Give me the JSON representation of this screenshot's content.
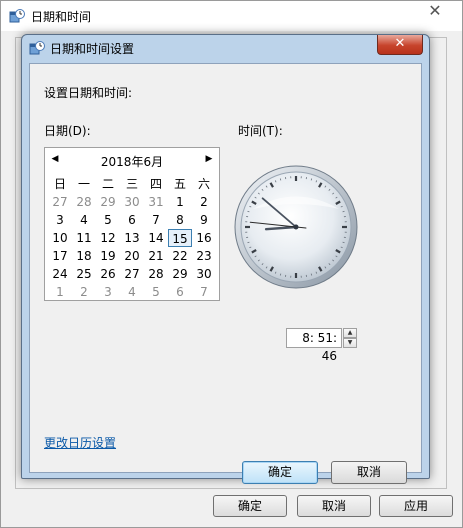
{
  "background_window": {
    "title": "日期和时间",
    "close_label": "✕",
    "ok_label": "确定",
    "cancel_label": "取消",
    "apply_label": "应用"
  },
  "dialog": {
    "title": "日期和时间设置",
    "close_label": "✕",
    "instruction": "设置日期和时间:",
    "date_label": "日期(D):",
    "time_label": "时间(T):",
    "calendar": {
      "month_title": "2018年6月",
      "prev_icon": "triangle-left-icon",
      "next_icon": "triangle-right-icon",
      "weekdays": [
        "日",
        "一",
        "二",
        "三",
        "四",
        "五",
        "六"
      ],
      "weeks": [
        [
          "27",
          "28",
          "29",
          "30",
          "31",
          "1",
          "2"
        ],
        [
          "3",
          "4",
          "5",
          "6",
          "7",
          "8",
          "9"
        ],
        [
          "10",
          "11",
          "12",
          "13",
          "14",
          "15",
          "16"
        ],
        [
          "17",
          "18",
          "19",
          "20",
          "21",
          "22",
          "23"
        ],
        [
          "24",
          "25",
          "26",
          "27",
          "28",
          "29",
          "30"
        ],
        [
          "1",
          "2",
          "3",
          "4",
          "5",
          "6",
          "7"
        ]
      ],
      "selected_day": "15"
    },
    "clock": {
      "hour": 8,
      "minute": 51,
      "second": 46
    },
    "time_value": "8: 51: 46",
    "change_calendar_link": "更改日历设置",
    "ok_label": "确定",
    "cancel_label": "取消"
  },
  "colors": {
    "link": "#0a59a8",
    "close_button": "#c7442c",
    "second_hand": "#2a2a2a"
  }
}
